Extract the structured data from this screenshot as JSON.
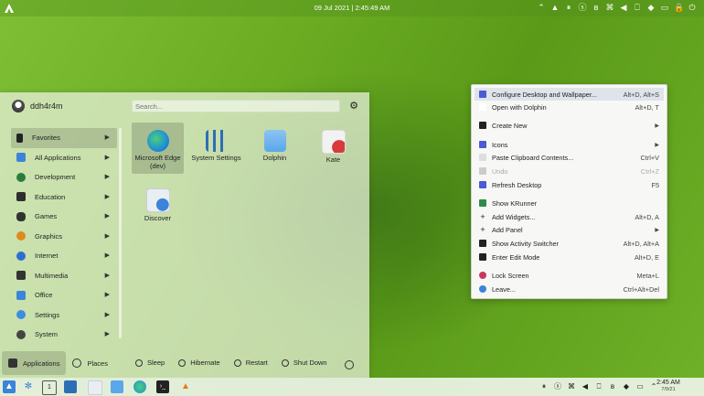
{
  "topbar": {
    "clock": "09 Jul 2021 | 2:45:49 AM",
    "tray_icons": [
      "arrow-icon",
      "nordvpn-icon",
      "pause-icon",
      "sb-icon",
      "bluetooth-icon",
      "paperclip-icon",
      "volume-icon",
      "network-icon",
      "wifi-icon",
      "battery-icon",
      "lock-icon",
      "power-icon"
    ]
  },
  "launcher": {
    "username": "ddh4r4m",
    "search_placeholder": "Search...",
    "categories": [
      {
        "label": "Favorites",
        "color": "#222222"
      },
      {
        "label": "All Applications",
        "color": "#3b84d9"
      },
      {
        "label": "Development",
        "color": "#2a7d3c"
      },
      {
        "label": "Education",
        "color": "#2d2d2d"
      },
      {
        "label": "Games",
        "color": "#333333"
      },
      {
        "label": "Graphics",
        "color": "#e08a1e"
      },
      {
        "label": "Internet",
        "color": "#2a6fd1"
      },
      {
        "label": "Multimedia",
        "color": "#333333"
      },
      {
        "label": "Office",
        "color": "#3a86d6"
      },
      {
        "label": "Settings",
        "color": "#3d8ee0"
      },
      {
        "label": "System",
        "color": "#444444"
      }
    ],
    "apps": [
      {
        "label": "Microsoft Edge (dev)",
        "color": "#1f8fd8"
      },
      {
        "label": "System Settings",
        "color": "#2d6fb5"
      },
      {
        "label": "Dolphin",
        "color": "#5aa7ea"
      },
      {
        "label": "Kate",
        "color": "#f2f2f2"
      },
      {
        "label": "Discover",
        "color": "#e9eef2"
      }
    ],
    "power": [
      "Sleep",
      "Hibernate",
      "Restart",
      "Shut Down"
    ],
    "tabs": [
      "Applications",
      "Places"
    ]
  },
  "context_menu": {
    "items": [
      {
        "label": "Configure Desktop and Wallpaper...",
        "shortcut": "Alt+D, Alt+S",
        "icon_color": "#4a5bd4"
      },
      {
        "label": "Open with Dolphin",
        "shortcut": "Alt+D, T",
        "icon_color": "#ffffff"
      },
      {
        "label": "Create New",
        "shortcut": "",
        "icon_color": "#222222"
      },
      {
        "label": "Icons",
        "shortcut": "",
        "icon_color": "#4a5bd4"
      },
      {
        "label": "Paste Clipboard Contents...",
        "shortcut": "Ctrl+V",
        "icon_color": "#dddddd"
      },
      {
        "label": "Undo",
        "shortcut": "Ctrl+Z",
        "icon_color": "#cccccc"
      },
      {
        "label": "Refresh Desktop",
        "shortcut": "F5",
        "icon_color": "#4a5bd4"
      },
      {
        "label": "Show KRunner",
        "shortcut": "",
        "icon_color": "#2f8a4c"
      },
      {
        "label": "Add Widgets...",
        "shortcut": "Alt+D, A",
        "icon_color": "#222222"
      },
      {
        "label": "Add Panel",
        "shortcut": "",
        "icon_color": "#222222"
      },
      {
        "label": "Show Activity Switcher",
        "shortcut": "Alt+D, Alt+A",
        "icon_color": "#222222"
      },
      {
        "label": "Enter Edit Mode",
        "shortcut": "Alt+D, E",
        "icon_color": "#222222"
      },
      {
        "label": "Lock Screen",
        "shortcut": "Meta+L",
        "icon_color": "#c63a5a"
      },
      {
        "label": "Leave...",
        "shortcut": "Ctrl+Alt+Del",
        "icon_color": "#3b84d9"
      }
    ]
  },
  "taskbar": {
    "time": "2:45 AM",
    "date": "7/9/21"
  }
}
